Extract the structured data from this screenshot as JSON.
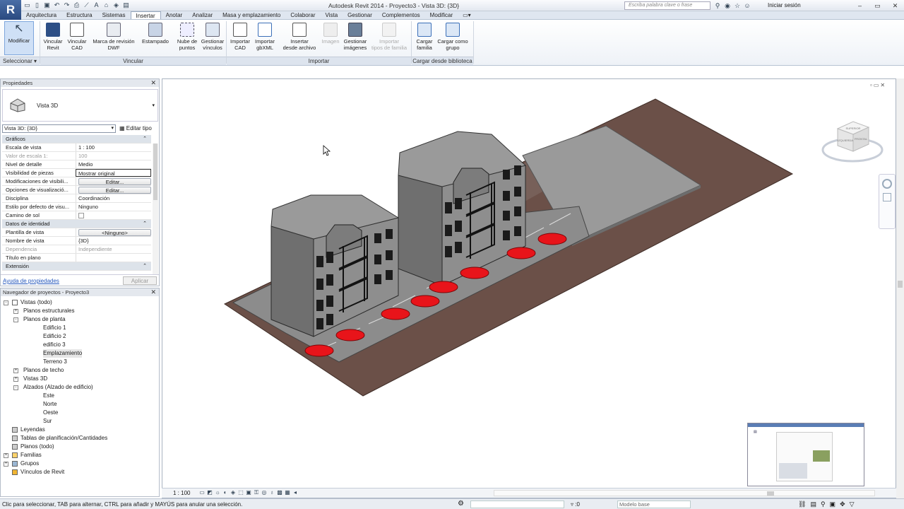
{
  "app": {
    "logo": "R",
    "window_title": "Autodesk Revit 2014 -     Proyecto3 - Vista 3D: {3D}",
    "search_placeholder": "Escriba palabra clave o frase",
    "signin_label": "Iniciar sesión",
    "colors": {
      "accent": "#2a4a80",
      "car": "#e8141a",
      "ground": "#6b5048",
      "building": "#8e8e8e"
    }
  },
  "qat_icons": [
    "folder-open-icon",
    "new-icon",
    "save-icon",
    "undo-icon",
    "redo-icon",
    "print-icon",
    "measure-icon",
    "text-icon",
    "3d-view-icon",
    "section-icon",
    "switch-window-icon"
  ],
  "tabs": [
    "Arquitectura",
    "Estructura",
    "Sistemas",
    "Insertar",
    "Anotar",
    "Analizar",
    "Masa y emplazamiento",
    "Colaborar",
    "Vista",
    "Gestionar",
    "Complementos",
    "Modificar"
  ],
  "active_tab": "Insertar",
  "ribbon": {
    "buttons": [
      {
        "id": "modificar",
        "l1": "Modificar",
        "l2": ""
      },
      {
        "id": "vincular-revit",
        "l1": "Vincular",
        "l2": "Revit"
      },
      {
        "id": "vincular-cad",
        "l1": "Vincular",
        "l2": "CAD"
      },
      {
        "id": "marca-revision",
        "l1": "Marca de revisión",
        "l2": "DWF"
      },
      {
        "id": "estampado",
        "l1": "Estampado",
        "l2": ""
      },
      {
        "id": "nube-puntos",
        "l1": "Nube de",
        "l2": "puntos"
      },
      {
        "id": "gestionar-vinculos",
        "l1": "Gestionar",
        "l2": "vínculos"
      },
      {
        "id": "importar-cad",
        "l1": "Importar",
        "l2": "CAD"
      },
      {
        "id": "importar-gbxml",
        "l1": "Importar",
        "l2": "gbXML"
      },
      {
        "id": "insertar-archivo",
        "l1": "Insertar",
        "l2": "desde archivo"
      },
      {
        "id": "imagen",
        "l1": "Imagen",
        "l2": ""
      },
      {
        "id": "gestionar-imagenes",
        "l1": "Gestionar",
        "l2": "imágenes"
      },
      {
        "id": "importar-tipos",
        "l1": "Importar",
        "l2": "tipos de familia"
      },
      {
        "id": "cargar-familia",
        "l1": "Cargar",
        "l2": "familia"
      },
      {
        "id": "cargar-grupo",
        "l1": "Cargar como",
        "l2": "grupo"
      }
    ],
    "panels": [
      "Seleccionar",
      "Vincular",
      "Importar",
      "Cargar desde biblioteca"
    ]
  },
  "properties": {
    "header": "Propiedades",
    "type_name": "Vista 3D",
    "view_selector": "Vista 3D: {3D}",
    "edit_type": "Editar tipo",
    "rows": [
      {
        "k": "Gráficos",
        "v": "",
        "kind": "group"
      },
      {
        "k": "Escala de vista",
        "v": "1 : 100",
        "kind": "text"
      },
      {
        "k": "Valor de escala    1:",
        "v": "100",
        "kind": "dis"
      },
      {
        "k": "Nivel de detalle",
        "v": "Medio",
        "kind": "text"
      },
      {
        "k": "Visibilidad de piezas",
        "v": "Mostrar original",
        "kind": "boxed"
      },
      {
        "k": "Modificaciones de visibili...",
        "v": "Editar...",
        "kind": "btn"
      },
      {
        "k": "Opciones de visualizació...",
        "v": "Editar...",
        "kind": "btn"
      },
      {
        "k": "Disciplina",
        "v": "Coordinación",
        "kind": "text"
      },
      {
        "k": "Estilo por defecto de visu...",
        "v": "Ninguno",
        "kind": "text"
      },
      {
        "k": "Camino de sol",
        "v": "",
        "kind": "cb"
      },
      {
        "k": "Datos de identidad",
        "v": "",
        "kind": "group"
      },
      {
        "k": "Plantilla de vista",
        "v": "<Ninguno>",
        "kind": "btn"
      },
      {
        "k": "Nombre de vista",
        "v": "{3D}",
        "kind": "text"
      },
      {
        "k": "Dependencia",
        "v": "Independiente",
        "kind": "dis"
      },
      {
        "k": "Título en plano",
        "v": "",
        "kind": "text"
      },
      {
        "k": "Extensión",
        "v": "",
        "kind": "group"
      }
    ],
    "help_link": "Ayuda de propiedades",
    "apply_label": "Aplicar"
  },
  "browser": {
    "header": "Navegador de proyectos - Proyecto3",
    "nodes": [
      {
        "label": "Vistas (todo)",
        "level": 0,
        "pm": "-",
        "icon": "views-icon"
      },
      {
        "label": "Planos estructurales",
        "level": 1,
        "pm": "+"
      },
      {
        "label": "Planos de planta",
        "level": 1,
        "pm": "-"
      },
      {
        "label": "Edificio 1",
        "level": 2,
        "pm": ""
      },
      {
        "label": "Edificio 2",
        "level": 2,
        "pm": ""
      },
      {
        "label": "edificio 3",
        "level": 2,
        "pm": ""
      },
      {
        "label": "Emplazamiento",
        "level": 2,
        "pm": "",
        "sel": true
      },
      {
        "label": "Terreno 3",
        "level": 2,
        "pm": ""
      },
      {
        "label": "Planos de techo",
        "level": 1,
        "pm": "+"
      },
      {
        "label": "Vistas 3D",
        "level": 1,
        "pm": "+"
      },
      {
        "label": "Alzados (Alzado de edificio)",
        "level": 1,
        "pm": "-"
      },
      {
        "label": "Este",
        "level": 2,
        "pm": ""
      },
      {
        "label": "Norte",
        "level": 2,
        "pm": ""
      },
      {
        "label": "Oeste",
        "level": 2,
        "pm": ""
      },
      {
        "label": "Sur",
        "level": 2,
        "pm": ""
      },
      {
        "label": "Leyendas",
        "level": 0,
        "pm": "",
        "icon": "legend-icon"
      },
      {
        "label": "Tablas de planificación/Cantidades",
        "level": 0,
        "pm": "",
        "icon": "schedule-icon"
      },
      {
        "label": "Planos (todo)",
        "level": 0,
        "pm": "",
        "icon": "sheet-icon"
      },
      {
        "label": "Familias",
        "level": 0,
        "pm": "+",
        "icon": "family-icon"
      },
      {
        "label": "Grupos",
        "level": 0,
        "pm": "+",
        "icon": "group-icon"
      },
      {
        "label": "Vínculos de Revit",
        "level": 0,
        "pm": "",
        "icon": "link-icon"
      }
    ]
  },
  "viewcube": {
    "top": "SUPERIOR",
    "left": "IZQUIERDA",
    "front": "FRONTAL"
  },
  "view_scale": "1 : 100",
  "status": {
    "message": "Clic para seleccionar, TAB para alternar, CTRL para añadir y MAYÚS para anular una selección.",
    "selection_count": ":0",
    "model": "Modelo base"
  }
}
